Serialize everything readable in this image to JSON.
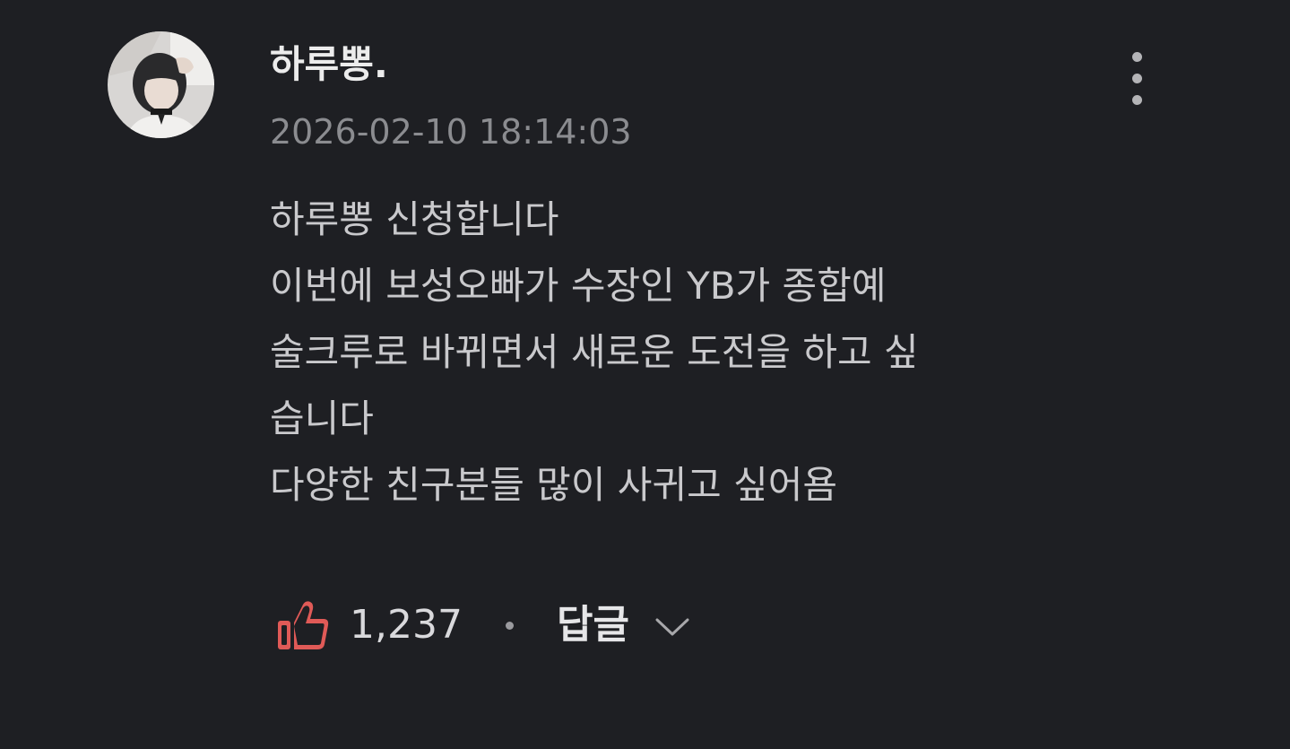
{
  "comment": {
    "author": "하루뽕.",
    "timestamp": "2026-02-10 18:14:03",
    "body_lines": [
      "하루뽕 신청합니다",
      "이번에 보성오빠가 수장인 YB가 종합예",
      "술크루로 바뀌면서 새로운 도전을 하고 싶",
      "습니다",
      "다양한 친구분들 많이 사귀고 싶어욤"
    ],
    "like_count": "1,237",
    "reply_label": "답글"
  },
  "icons": {
    "avatar": "user-avatar-photo",
    "more": "vertical-ellipsis-icon",
    "like": "thumbs-up-icon",
    "expand": "chevron-down-icon"
  },
  "colors": {
    "background": "#1e1f23",
    "like_icon": "#e05a57",
    "text_primary": "#ececec",
    "text_secondary": "#8b8c90"
  }
}
